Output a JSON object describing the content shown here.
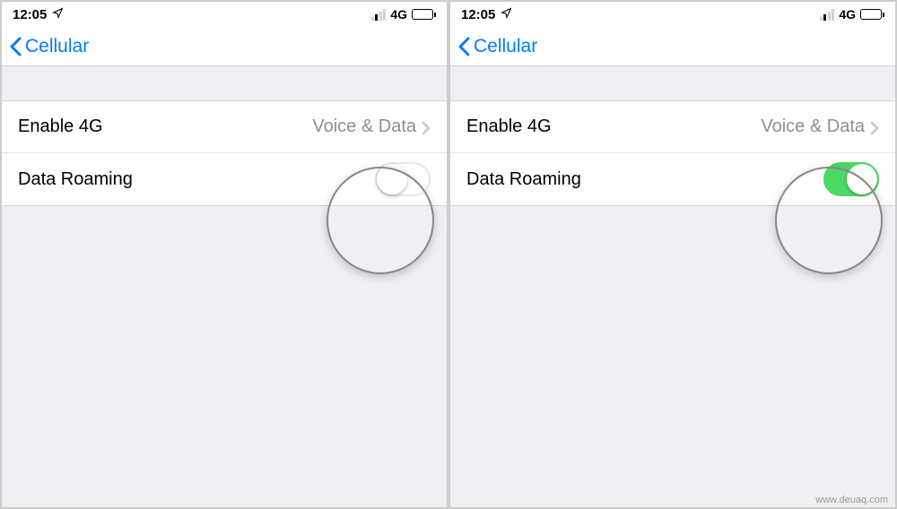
{
  "status": {
    "time": "12:05",
    "network_label": "4G"
  },
  "nav": {
    "back_label": "Cellular"
  },
  "rows": {
    "enable4g": {
      "label": "Enable 4G",
      "value": "Voice & Data"
    },
    "roaming": {
      "label": "Data Roaming"
    }
  },
  "left_panel": {
    "roaming_on": false
  },
  "right_panel": {
    "roaming_on": true
  },
  "watermark": "www.deuaq.com"
}
